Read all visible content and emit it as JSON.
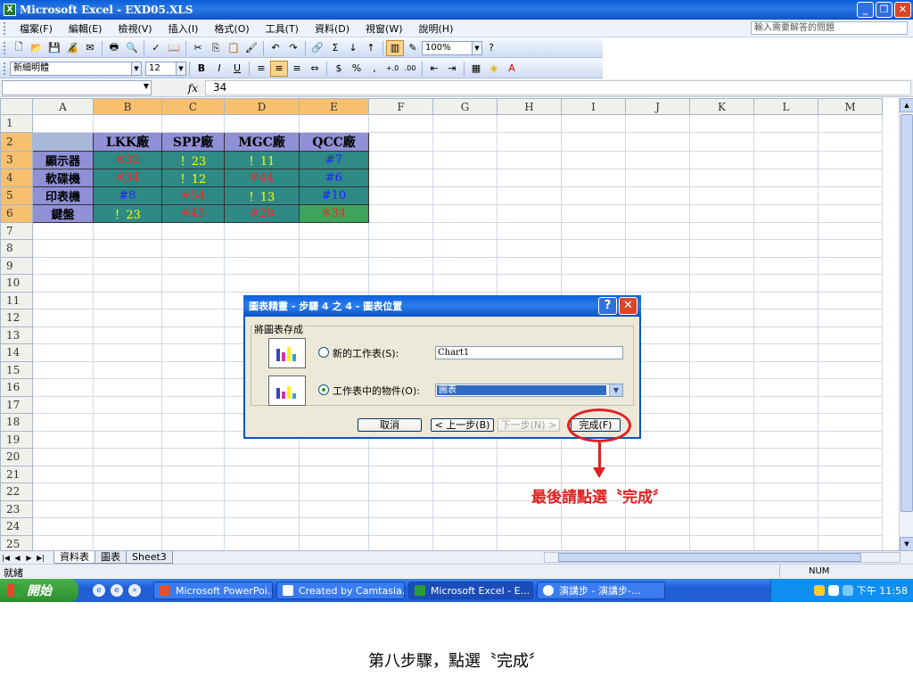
{
  "window": {
    "title": "Microsoft Excel - EXD05.XLS",
    "app_icon_letter": "X",
    "minimize": "_",
    "restore": "❐",
    "close": "✕"
  },
  "menu": {
    "items": [
      "檔案(F)",
      "編輯(E)",
      "檢視(V)",
      "插入(I)",
      "格式(O)",
      "工具(T)",
      "資料(D)",
      "視窗(W)",
      "說明(H)"
    ],
    "ask_placeholder": "輸入需要解答的問題"
  },
  "toolbar": {
    "zoom": "100%",
    "font_name": "新細明體",
    "font_size": "12",
    "bold": "B",
    "italic": "I",
    "underline": "U",
    "currency": "$",
    "percent": "%",
    "comma": ",",
    "increase_decimal": "+.0",
    "decrease_decimal": ".00"
  },
  "formula_bar": {
    "name_box": "",
    "fx": "fx",
    "content": "34"
  },
  "sheet": {
    "columns": [
      "A",
      "B",
      "C",
      "D",
      "E",
      "F",
      "G",
      "H",
      "I",
      "J",
      "K",
      "L",
      "M"
    ],
    "rows": [
      "1",
      "2",
      "3",
      "4",
      "5",
      "6",
      "7",
      "8",
      "9",
      "10",
      "11",
      "12",
      "13",
      "14",
      "15",
      "16",
      "17",
      "18",
      "19",
      "20",
      "21",
      "22",
      "23",
      "24",
      "25"
    ],
    "headers": [
      "LKK廠",
      "SPP廠",
      "MGC廠",
      "QCC廠"
    ],
    "labels": [
      "顯示器",
      "軟碟機",
      "印表機",
      "鍵盤"
    ],
    "cells": [
      [
        "※32",
        "！23",
        "！11",
        "#7"
      ],
      [
        "※34",
        "！12",
        "※44",
        "#6"
      ],
      [
        "#8",
        "※54",
        "！13",
        "#10"
      ],
      [
        "！23",
        "※45",
        "※28",
        "※34"
      ]
    ],
    "colors": {
      "header_fill": "#8f90d6",
      "data_fill": "#2f8a86",
      "highlight_fill": "#3ea45c",
      "star_text": "#ff2020",
      "excl_text": "#ffff00",
      "hash_text": "#2020ff"
    }
  },
  "tabs": {
    "nav": [
      "|◀",
      "◀",
      "▶",
      "▶|"
    ],
    "sheets": [
      "資料表",
      "圖表",
      "Sheet3"
    ]
  },
  "status": {
    "ready": "就緒",
    "num": "NUM"
  },
  "taskbar": {
    "start": "開始",
    "items": [
      "Microsoft PowerPoi...",
      "Created by Camtasia...",
      "Microsoft Excel - E...",
      "演講步 - 演講步-..."
    ],
    "clock": "下午 11:58"
  },
  "dialog": {
    "title": "圖表精靈 - 步驟 4 之 4 - 圖表位置",
    "help": "?",
    "close": "✕",
    "group_label": "將圖表存成",
    "option_new_sheet": "新的工作表(S):",
    "new_sheet_value": "Chart1",
    "option_object": "工作表中的物件(O):",
    "object_value": "圖表",
    "cancel": "取消",
    "back": "< 上一步(B)",
    "next": "下一步(N) >",
    "finish": "完成(F)"
  },
  "annotation": {
    "note": "最後請點選〝完成〞",
    "caption": "第八步驟，點選〝完成〞"
  }
}
